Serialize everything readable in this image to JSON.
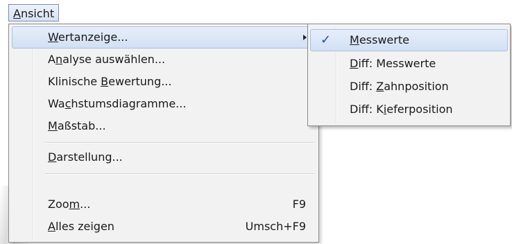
{
  "menubar": {
    "title": "Ansicht",
    "title_mnemonic": "A",
    "title_rest": "nsicht"
  },
  "menu": {
    "items": [
      {
        "id": "wertanzeige",
        "pre": "",
        "key": "W",
        "post": "ertanzeige...",
        "shortcut": "",
        "submenu": true,
        "highlighted": true
      },
      {
        "id": "analyse",
        "pre": "A",
        "key": "n",
        "post": "alyse auswählen...",
        "shortcut": ""
      },
      {
        "id": "klinische",
        "pre": "Klinische ",
        "key": "B",
        "post": "ewertung...",
        "shortcut": ""
      },
      {
        "id": "wachstum",
        "pre": "Wa",
        "key": "c",
        "post": "hstumsdiagramme...",
        "shortcut": ""
      },
      {
        "id": "massstab",
        "pre": "",
        "key": "M",
        "post": "aßstab...",
        "shortcut": ""
      },
      {
        "id": "darstellung",
        "pre": "",
        "key": "D",
        "post": "arstellung...",
        "shortcut": ""
      },
      {
        "id": "zoom",
        "pre": "Zoo",
        "key": "m",
        "post": "...",
        "shortcut": "F9"
      },
      {
        "id": "alles",
        "pre": "",
        "key": "A",
        "post": "lles zeigen",
        "shortcut": "Umsch+F9"
      }
    ]
  },
  "submenu": {
    "items": [
      {
        "id": "messwerte",
        "pre": "",
        "key": "M",
        "post": "esswerte",
        "checked": true,
        "highlighted": true
      },
      {
        "id": "diff-messwerte",
        "pre": "",
        "key": "D",
        "post": "iff: Messwerte",
        "checked": false
      },
      {
        "id": "diff-zahnposition",
        "pre": "Diff: ",
        "key": "Z",
        "post": "ahnposition",
        "checked": false
      },
      {
        "id": "diff-kieferposition",
        "pre": "Diff: K",
        "key": "i",
        "post": "eferposition",
        "checked": false
      }
    ],
    "check_glyph": "✓"
  },
  "colors": {
    "highlight_border": "#a9c0e0",
    "highlight_fill": "#d2e0f4",
    "menu_bg": "#f2f2f2",
    "check": "#1d4f91"
  }
}
